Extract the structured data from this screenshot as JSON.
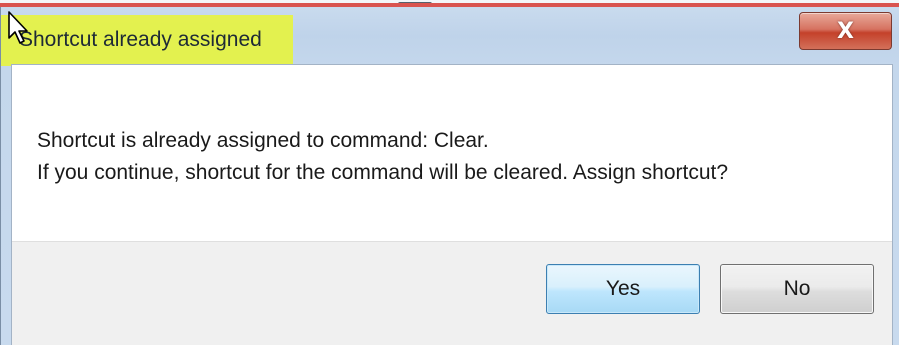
{
  "dialog": {
    "title": "Shortcut already assigned",
    "close_symbol": "X",
    "message_line1": "Shortcut is already assigned to command: Clear.",
    "message_line2": "If you continue, shortcut for the command will be cleared. Assign shortcut?"
  },
  "buttons": {
    "yes_label": "Yes",
    "no_label": "No"
  },
  "colors": {
    "title_highlight": "#e6f341",
    "close_button": "#c4412a",
    "yes_button_border": "#3c7fb1",
    "top_red_line": "#d9534f"
  },
  "icons": {
    "cursor": "mouse-pointer-icon",
    "close": "close-icon"
  }
}
